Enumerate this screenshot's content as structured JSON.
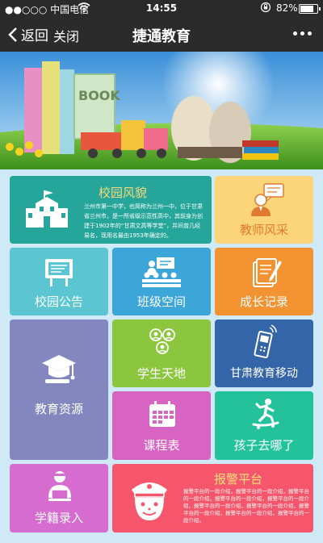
{
  "status_bar": {
    "carrier": "●●○○○ 中国电信",
    "time": "14:55",
    "battery": "82%"
  },
  "nav": {
    "back_label": "返回",
    "close_label": "关闭",
    "title": "捷通教育"
  },
  "banner": {
    "book_text": "BOOK"
  },
  "tiles": {
    "campus_style": {
      "label": "校园风貌",
      "description": "兰州市第一中学，也简称为兰州一中，位于甘肃省兰州市，是一所省级示范性高中，其前身为创建于1902年的“甘肃文高等学堂”，并间曾几经易名，现用名最由1953年确定的。",
      "color": "#26a69a"
    },
    "teacher_style": {
      "label": "教师风采",
      "color": "#fcd57a"
    },
    "campus_notice": {
      "label": "校园公告",
      "color": "#5bc6d1"
    },
    "class_space": {
      "label": "班级空间",
      "color": "#3ca6d9"
    },
    "growth_record": {
      "label": "成长记录",
      "color": "#f39230"
    },
    "education_resources": {
      "label": "教育资源",
      "color": "#8487bf"
    },
    "student_world": {
      "label": "学生天地",
      "color": "#8cc63f"
    },
    "gansu_mobile": {
      "label": "甘肃教育移动",
      "color": "#3465a8"
    },
    "course_schedule": {
      "label": "课程表",
      "color": "#d764c3"
    },
    "child_location": {
      "label": "孩子去哪了",
      "color": "#23c29a"
    },
    "student_enrollment": {
      "label": "学籍录入",
      "color": "#d76cd0"
    },
    "alarm_platform": {
      "label": "报警平台",
      "description": "报警平台的一段介绍，报警平台的一段介绍，报警平台的一段介绍，报警平台的一段介绍，报警平台的一段介绍，报警平台的一段介绍，报警平台的一段介绍，报警平台的一段介绍，报警平台的一段介绍，报警平台的一段介绍。",
      "color": "#f5566b"
    }
  }
}
